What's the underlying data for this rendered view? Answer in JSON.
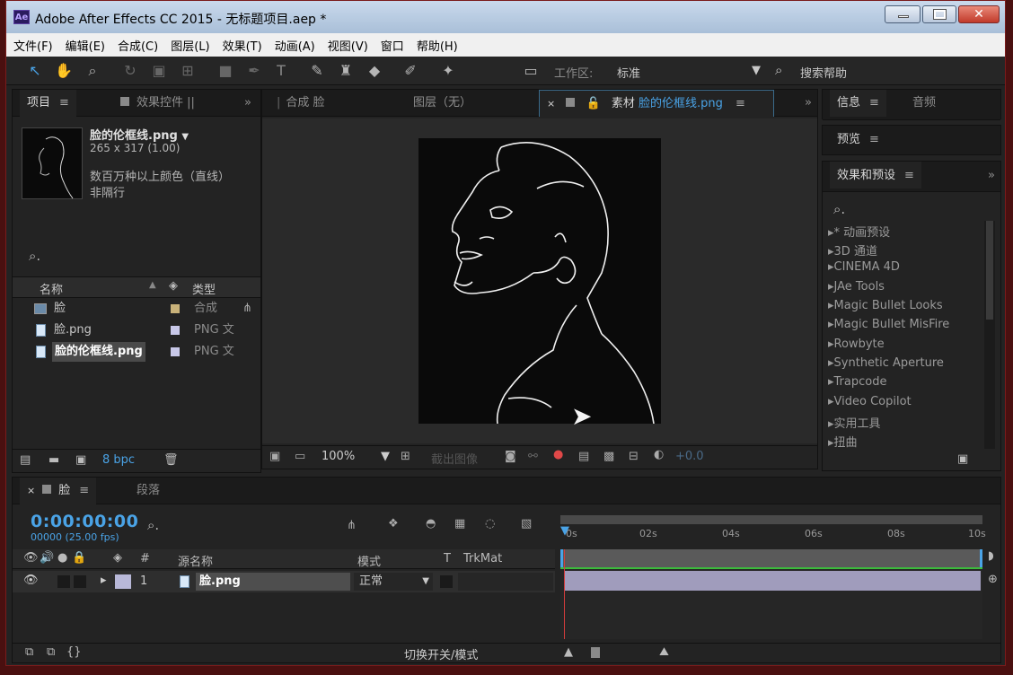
{
  "window": {
    "app_icon": "Ae",
    "title": "Adobe After Effects CC 2015 - 无标题项目.aep *"
  },
  "menu": [
    "文件(F)",
    "编辑(E)",
    "合成(C)",
    "图层(L)",
    "效果(T)",
    "动画(A)",
    "视图(V)",
    "窗口",
    "帮助(H)"
  ],
  "toolbar": {
    "workspace_label": "工作区:",
    "workspace_value": "标准",
    "search_help": "搜索帮助"
  },
  "project": {
    "tab_label": "项目",
    "tab_effects": "效果控件",
    "tab_effects_suffix": "||",
    "preview_name": "脸的伦框线.png",
    "preview_dims": "265 x 317 (1.00)",
    "preview_colors": "数百万种以上颜色（直线）",
    "preview_interlace": "非隔行",
    "col_name": "名称",
    "col_type": "类型",
    "items": [
      {
        "name": "脸",
        "type": "合成",
        "swatch": "#c9b27a"
      },
      {
        "name": "脸.png",
        "type": "PNG 文",
        "swatch": "#c8c8e8"
      },
      {
        "name": "脸的伦框线.png",
        "type": "PNG 文",
        "swatch": "#c8c8e8"
      }
    ],
    "bpc": "8 bpc"
  },
  "viewer": {
    "tab_comp": "合成 脸",
    "tab_layer": "图层（无）",
    "tab_footage_prefix": "素材",
    "tab_footage_name": "脸的伦框线.png",
    "zoom": "100%",
    "extract": "截出图像",
    "exposure": "+0.0"
  },
  "right_panels": {
    "info": "信息",
    "audio": "音频",
    "preview": "预览",
    "effects_presets": "效果和预设",
    "effects_list": [
      "* 动画预设",
      "3D 通道",
      "CINEMA 4D",
      "JAe Tools",
      "Magic Bullet Looks",
      "Magic Bullet MisFire",
      "Rowbyte",
      "Synthetic Aperture",
      "Trapcode",
      "Video Copilot",
      "实用工具",
      "扭曲"
    ]
  },
  "timeline": {
    "tab_comp": "脸",
    "tab_render": "段落",
    "timecode": "0:00:00:00",
    "frames": "00000 (25.00 fps)",
    "col_num": "#",
    "col_source": "源名称",
    "col_mode": "模式",
    "col_t": "T",
    "col_trkmat": "TrkMat",
    "ruler": [
      "0s",
      "02s",
      "04s",
      "06s",
      "08s",
      "10s"
    ],
    "layer": {
      "index": "1",
      "name": "脸.png",
      "mode": "正常"
    },
    "footer_toggle": "切换开关/模式"
  }
}
